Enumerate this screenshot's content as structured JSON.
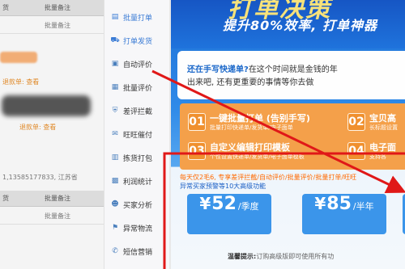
{
  "background_table": {
    "header_a": "货",
    "header_b": "批量备注",
    "row_text_1": "批量备注",
    "row_link_1": "退款单: 查看",
    "row_link_2": "退款单: 查看",
    "row_phone": "1,13585177833, 江苏省",
    "header_c": "货",
    "header_d": "批量备注",
    "row_text_2": "批量备注"
  },
  "sidebar": {
    "items": [
      {
        "label": "批量打单",
        "icon": "print-icon",
        "active": true
      },
      {
        "label": "打单发货",
        "icon": "ship-icon",
        "active": true
      },
      {
        "label": "自动评价",
        "icon": "comment-icon"
      },
      {
        "label": "批量评价",
        "icon": "batch-comment-icon"
      },
      {
        "label": "差评拦截",
        "icon": "shield-icon"
      },
      {
        "label": "旺旺催付",
        "icon": "chat-icon"
      },
      {
        "label": "拣货打包",
        "icon": "package-icon"
      },
      {
        "label": "利润统计",
        "icon": "stats-icon"
      },
      {
        "label": "买家分析",
        "icon": "user-analysis-icon"
      },
      {
        "label": "异常物流",
        "icon": "logistics-icon"
      },
      {
        "label": "短信营销",
        "icon": "sms-icon"
      }
    ]
  },
  "banner": {
    "title": "打单决策",
    "subtitle": "提升80%效率, 打单神器"
  },
  "intro": {
    "question_prefix": "还在手写快递单?",
    "question_rest": "在这个时间就是金钱的年",
    "line2": "出来吧, 还有更重要的事情等你去做"
  },
  "features": [
    {
      "num": "01",
      "title": "一键批量打单 (告别手写)",
      "desc": "批量打印快递单/发货单/电子面单"
    },
    {
      "num": "02",
      "title": "宝贝高",
      "desc": "长标题设置"
    },
    {
      "num": "03",
      "title": "自定义编辑打印模板",
      "desc": "个性设置快递单/发货单/电子面单模板"
    },
    {
      "num": "04",
      "title": "电子面",
      "desc": "支持各"
    }
  ],
  "notice": {
    "line1": "每天仅2毛6, 专享差评拦截/自动评价/批量评价/批量打单/旺旺",
    "line2": "异常买家预警等10大高级功能"
  },
  "prices": [
    {
      "symbol": "¥",
      "amount": "52",
      "period": "/季度"
    },
    {
      "symbol": "¥",
      "amount": "85",
      "period": "/半年"
    }
  ],
  "tip": {
    "label": "温馨提示:",
    "text": "订购高级版即可使用所有功"
  },
  "colors": {
    "primary_blue": "#1f73dc",
    "orange": "#f4a04a",
    "price_blue": "#3b95ea",
    "annotation_red": "#e01818"
  }
}
